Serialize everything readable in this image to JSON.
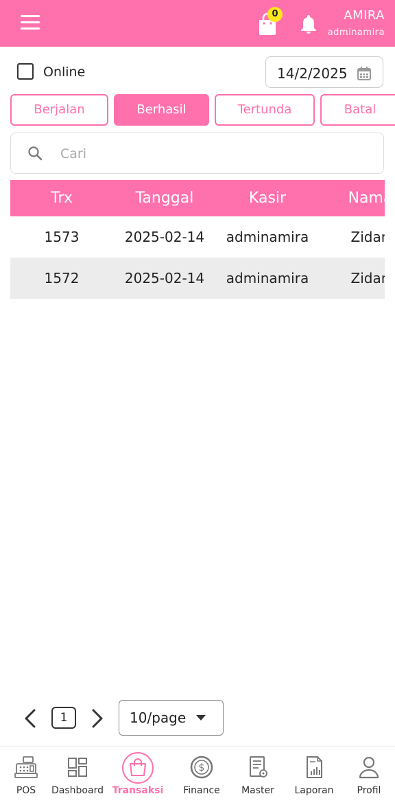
{
  "header": {
    "cart_count": "0",
    "user_name": "AMIRA",
    "user_role": "adminamira"
  },
  "filters": {
    "online_label": "Online",
    "online_checked": false,
    "date": "14/2/2025"
  },
  "tabs": [
    {
      "label": "Berjalan",
      "active": false
    },
    {
      "label": "Berhasil",
      "active": true
    },
    {
      "label": "Tertunda",
      "active": false
    },
    {
      "label": "Batal",
      "active": false
    }
  ],
  "search": {
    "placeholder": "Cari"
  },
  "table": {
    "headers": [
      "Trx",
      "Tanggal",
      "Kasir",
      "Nama"
    ],
    "rows": [
      [
        "1573",
        "2025-02-14",
        "adminamira",
        "Zidan"
      ],
      [
        "1572",
        "2025-02-14",
        "adminamira",
        "Zidan"
      ]
    ]
  },
  "pagination": {
    "current_page": "1",
    "page_size": "10/page"
  },
  "bottom_nav": [
    {
      "label": "POS",
      "icon": "cash-register-icon"
    },
    {
      "label": "Dashboard",
      "icon": "dashboard-grid-icon"
    },
    {
      "label": "Transaksi",
      "icon": "shopping-bag-icon",
      "active": true
    },
    {
      "label": "Finance",
      "icon": "dollar-coin-icon"
    },
    {
      "label": "Master",
      "icon": "document-gear-icon"
    },
    {
      "label": "Laporan",
      "icon": "report-chart-icon"
    },
    {
      "label": "Profil",
      "icon": "user-icon"
    }
  ],
  "colors": {
    "accent": "#ff71ad",
    "badge": "#ffe61e",
    "row_alt": "#ececec"
  }
}
